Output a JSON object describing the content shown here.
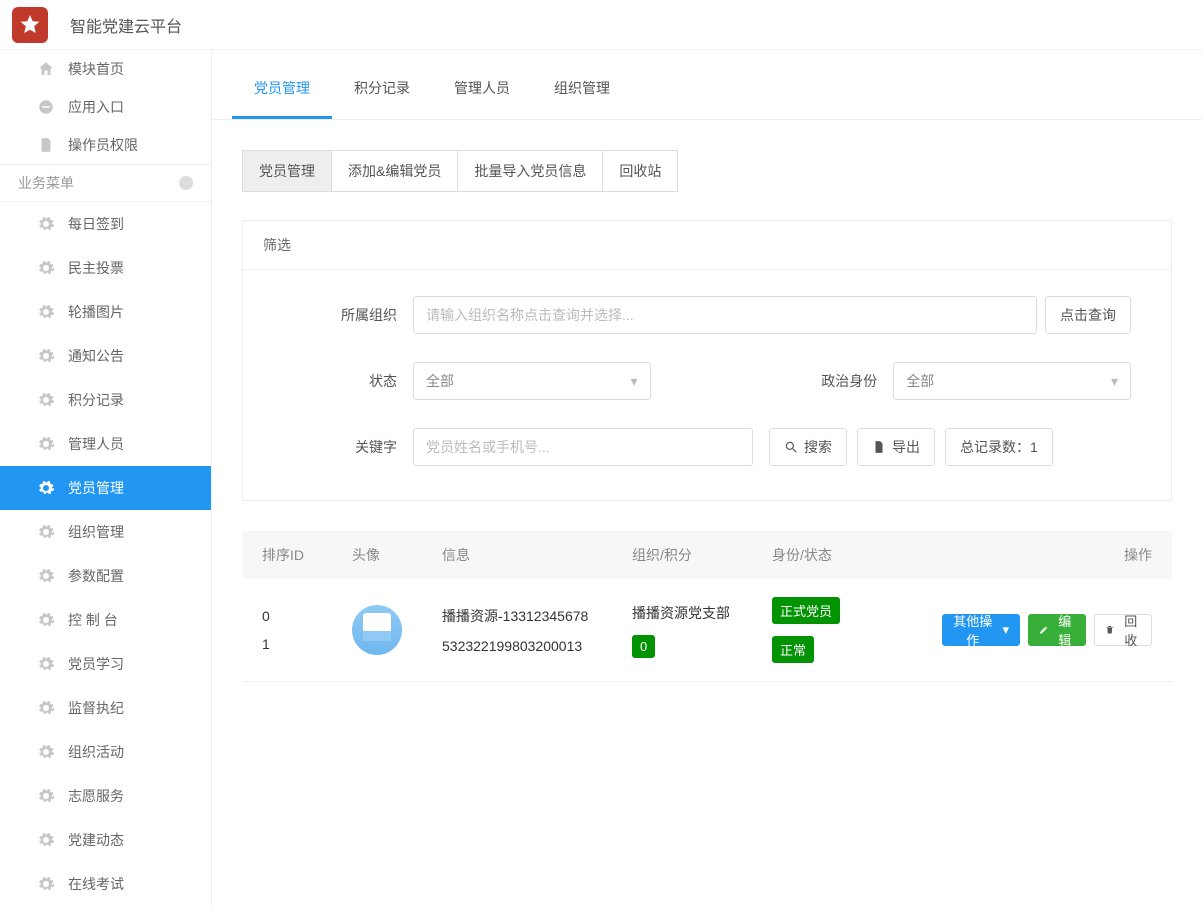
{
  "header": {
    "app_title": "智能党建云平台"
  },
  "sidebar": {
    "top": [
      {
        "label": "模块首页",
        "icon": "home"
      },
      {
        "label": "应用入口",
        "icon": "chat"
      },
      {
        "label": "操作员权限",
        "icon": "doc"
      }
    ],
    "section_label": "业务菜单",
    "items": [
      {
        "label": "每日签到"
      },
      {
        "label": "民主投票"
      },
      {
        "label": "轮播图片"
      },
      {
        "label": "通知公告"
      },
      {
        "label": "积分记录"
      },
      {
        "label": "管理人员"
      },
      {
        "label": "党员管理",
        "active": true
      },
      {
        "label": "组织管理"
      },
      {
        "label": "参数配置"
      },
      {
        "label": "控 制 台"
      },
      {
        "label": "党员学习"
      },
      {
        "label": "监督执纪"
      },
      {
        "label": "组织活动"
      },
      {
        "label": "志愿服务"
      },
      {
        "label": "党建动态"
      },
      {
        "label": "在线考试"
      }
    ]
  },
  "tabs": [
    "党员管理",
    "积分记录",
    "管理人员",
    "组织管理"
  ],
  "subtabs": [
    "党员管理",
    "添加&编辑党员",
    "批量导入党员信息",
    "回收站"
  ],
  "filter": {
    "title": "筛选",
    "org_label": "所属组织",
    "org_placeholder": "请输入组织名称点击查询并选择...",
    "org_btn": "点击查询",
    "status_label": "状态",
    "status_value": "全部",
    "identity_label": "政治身份",
    "identity_value": "全部",
    "keyword_label": "关键字",
    "keyword_placeholder": "党员姓名或手机号...",
    "search_btn": "搜索",
    "export_btn": "导出",
    "total_label": "总记录数：1"
  },
  "table": {
    "headers": {
      "id": "排序ID",
      "avatar": "头像",
      "info": "信息",
      "org": "组织/积分",
      "status": "身份/状态",
      "op": "操作"
    },
    "rows": [
      {
        "ids": [
          "0",
          "1"
        ],
        "info1": "播播资源-13312345678",
        "info2": "532322199803200013",
        "org1": "播播资源党支部",
        "org2_badge": "0",
        "status1_badge": "正式党员",
        "status2_badge": "正常",
        "ops": {
          "other": "其他操作",
          "edit": "编辑",
          "recycle": "回收"
        }
      }
    ]
  }
}
